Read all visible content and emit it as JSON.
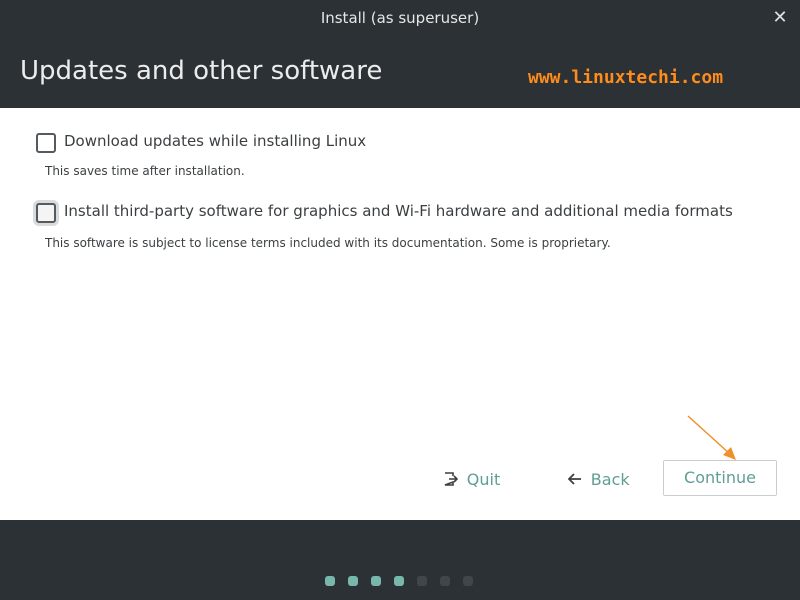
{
  "window": {
    "title": "Install (as superuser)",
    "close_icon": "close-icon",
    "close_glyph": "✕"
  },
  "header": {
    "heading": "Updates and other software",
    "watermark": "www.linuxtechi.com"
  },
  "options": [
    {
      "label": "Download updates while installing Linux",
      "description": "This saves time after installation.",
      "checked": false
    },
    {
      "label": "Install third-party software for graphics and Wi-Fi hardware and additional media formats",
      "description": "This software is subject to license terms included with its documentation. Some is proprietary.",
      "checked": false
    }
  ],
  "buttons": {
    "quit_label": "Quit",
    "quit_icon": "exit-icon",
    "back_label": "Back",
    "back_icon": "arrow-left-icon",
    "continue_label": "Continue"
  },
  "progress": {
    "total_steps": 7,
    "completed_steps": 4
  },
  "colors": {
    "chrome": "#2b3135",
    "accent": "#5f9e95",
    "dot_active": "#79b7ac",
    "watermark": "#ff8c1a",
    "annotation_arrow": "#f0902a"
  }
}
